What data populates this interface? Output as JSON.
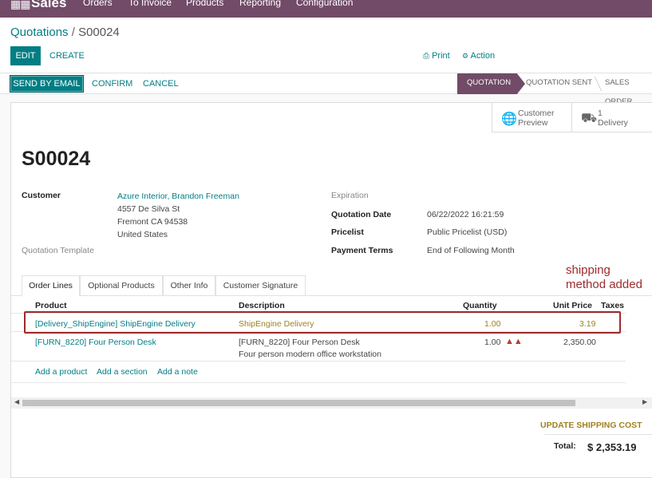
{
  "navbar": {
    "app_name": "Sales",
    "menu": [
      "Orders",
      "To Invoice",
      "Products",
      "Reporting",
      "Configuration"
    ]
  },
  "breadcrumb": {
    "parent": "Quotations",
    "separator": "/",
    "current": "S00024"
  },
  "control_panel": {
    "edit": "EDIT",
    "create": "CREATE",
    "print": "Print",
    "action": "Action"
  },
  "header": {
    "send_email": "SEND BY EMAIL",
    "confirm": "CONFIRM",
    "cancel": "CANCEL",
    "statuses": [
      "QUOTATION",
      "QUOTATION SENT",
      "SALES ORDER"
    ]
  },
  "smart_buttons": {
    "preview_line1": "Customer",
    "preview_line2": "Preview",
    "delivery_count": "1",
    "delivery_label": "Delivery"
  },
  "record": {
    "name": "S00024",
    "customer_label": "Customer",
    "customer_name": "Azure Interior, Brandon Freeman",
    "address_street": "4557 De Silva St",
    "address_city": "Fremont CA 94538",
    "address_country": "United States",
    "template_label": "Quotation Template",
    "expiration_label": "Expiration",
    "quotation_date_label": "Quotation Date",
    "quotation_date": "06/22/2022 16:21:59",
    "pricelist_label": "Pricelist",
    "pricelist": "Public Pricelist (USD)",
    "payment_terms_label": "Payment Terms",
    "payment_terms": "End of Following Month"
  },
  "tabs": [
    "Order Lines",
    "Optional Products",
    "Other Info",
    "Customer Signature"
  ],
  "table": {
    "headers": {
      "product": "Product",
      "description": "Description",
      "quantity": "Quantity",
      "unit_price": "Unit Price",
      "taxes": "Taxes"
    },
    "rows": [
      {
        "product": "[Delivery_ShipEngine] ShipEngine Delivery",
        "description": "ShipEngine Delivery",
        "quantity": "1.00",
        "unit_price": "3.19"
      },
      {
        "product": "[FURN_8220] Four Person Desk",
        "description": "[FURN_8220] Four Person Desk",
        "description2": "Four person modern office workstation",
        "quantity": "1.00",
        "unit_price": "2,350.00"
      }
    ],
    "add_product": "Add a product",
    "add_section": "Add a section",
    "add_note": "Add a note"
  },
  "footer": {
    "update_shipping": "UPDATE SHIPPING COST",
    "total_label": "Total:",
    "total_value": "$ 2,353.19"
  },
  "annotation": {
    "line1": "shipping",
    "line2": "method added"
  },
  "colors": {
    "brand": "#714b67",
    "accent": "#017e84",
    "annotation": "#9e2a2b",
    "delivery": "#a0821f"
  }
}
